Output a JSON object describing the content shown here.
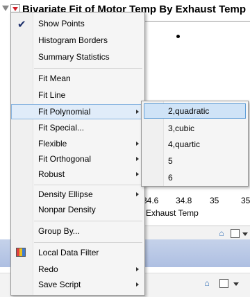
{
  "window": {
    "title": "Bivariate Fit of Motor Temp By Exhaust Temp"
  },
  "plot": {
    "x_ticks": [
      "34.6",
      "34.8",
      "35",
      "35"
    ],
    "x_axis_label": "Exhaust Temp"
  },
  "menu": {
    "items": [
      {
        "label": "Show Points",
        "checked": true
      },
      {
        "label": "Histogram Borders"
      },
      {
        "label": "Summary Statistics"
      },
      {
        "label": "Fit Mean"
      },
      {
        "label": "Fit Line"
      },
      {
        "label": "Fit Polynomial",
        "submenu": true,
        "highlighted": true
      },
      {
        "label": "Fit Special..."
      },
      {
        "label": "Flexible",
        "submenu": true
      },
      {
        "label": "Fit Orthogonal",
        "submenu": true
      },
      {
        "label": "Robust",
        "submenu": true
      },
      {
        "label": "Density Ellipse",
        "submenu": true
      },
      {
        "label": "Nonpar Density"
      },
      {
        "label": "Group By..."
      },
      {
        "label": "Local Data Filter",
        "icon": "data-filter-icon"
      },
      {
        "label": "Redo",
        "submenu": true
      },
      {
        "label": "Save Script",
        "submenu": true
      }
    ]
  },
  "submenu": {
    "items": [
      {
        "label": "2,quadratic",
        "highlighted": true
      },
      {
        "label": "3,cubic"
      },
      {
        "label": "4,quartic"
      },
      {
        "label": "5"
      },
      {
        "label": "6"
      }
    ]
  },
  "colors": {
    "highlight": "#cfe3f7",
    "highlight_border": "#5f9ed8",
    "title_arrow": "#d0202a"
  }
}
